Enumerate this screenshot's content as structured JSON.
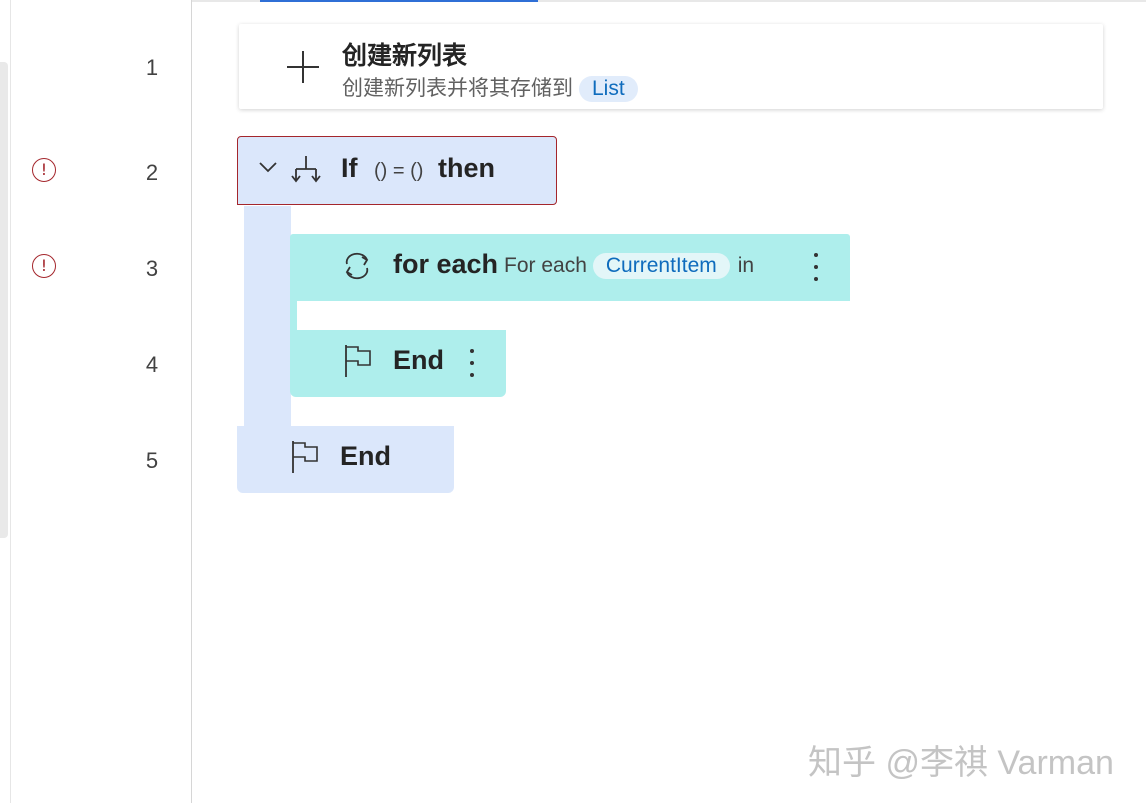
{
  "gutter": {
    "line_numbers": [
      "1",
      "2",
      "3",
      "4",
      "5"
    ],
    "error_glyph": "!"
  },
  "steps": {
    "create_list": {
      "title": "创建新列表",
      "description": "创建新列表并将其存储到",
      "variable": "List",
      "icon": "plus-icon"
    },
    "if_action": {
      "keyword": "If",
      "condition": "() = ()",
      "then": "then",
      "icon": "branch-icon",
      "status": "error"
    },
    "for_each": {
      "keyword": "for each",
      "description": "For each",
      "variable": "CurrentItem",
      "suffix": "in",
      "icon": "loop-icon",
      "status": "error"
    },
    "end_inner": {
      "label": "End",
      "icon": "flag-icon"
    },
    "end_outer": {
      "label": "End",
      "icon": "flag-icon"
    }
  },
  "watermark": "知乎 @李祺 Varman",
  "colors": {
    "error": "#a4262c",
    "if_block": "#dbe7fb",
    "loop_block": "#aeeeec",
    "token_text": "#0f6cbd",
    "token_bg": "#e1ecfb",
    "accent": "#2f6fd6"
  }
}
